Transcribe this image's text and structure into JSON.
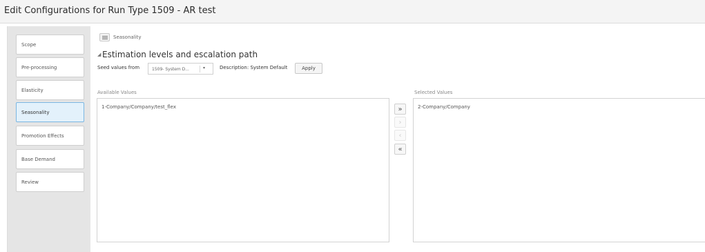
{
  "window": {
    "title": "Edit Configurations for Run Type 1509 - AR test"
  },
  "sidebar": {
    "items": [
      {
        "label": "Scope"
      },
      {
        "label": "Pre-processing"
      },
      {
        "label": "Elasticity"
      },
      {
        "label": "Seasonality"
      },
      {
        "label": "Promotion Effects"
      },
      {
        "label": "Base Demand"
      },
      {
        "label": "Review"
      }
    ],
    "active_index": 3
  },
  "header": {
    "menu_icon": "hamburger-icon",
    "breadcrumb": "Seasonality"
  },
  "section": {
    "caret": "◢",
    "title": "Estimation levels and escalation path"
  },
  "seed": {
    "label": "Seed values from",
    "selected": "1509- System D...",
    "caret": "▾",
    "description": "Description: System Default",
    "apply_label": "Apply"
  },
  "shuttle": {
    "available_label": "Available Values",
    "selected_label": "Selected Values",
    "available_items": [
      "1-Company/Company/test_flex"
    ],
    "selected_items": [
      "2-Company/Company"
    ],
    "buttons": {
      "move_all_right": "»",
      "move_right": "›",
      "move_left": "‹",
      "move_all_left": "«"
    }
  },
  "colors": {
    "sidebar_bg": "#e5e5e5",
    "active_bg": "#e3f1fb",
    "active_border": "#7ab6e2"
  }
}
